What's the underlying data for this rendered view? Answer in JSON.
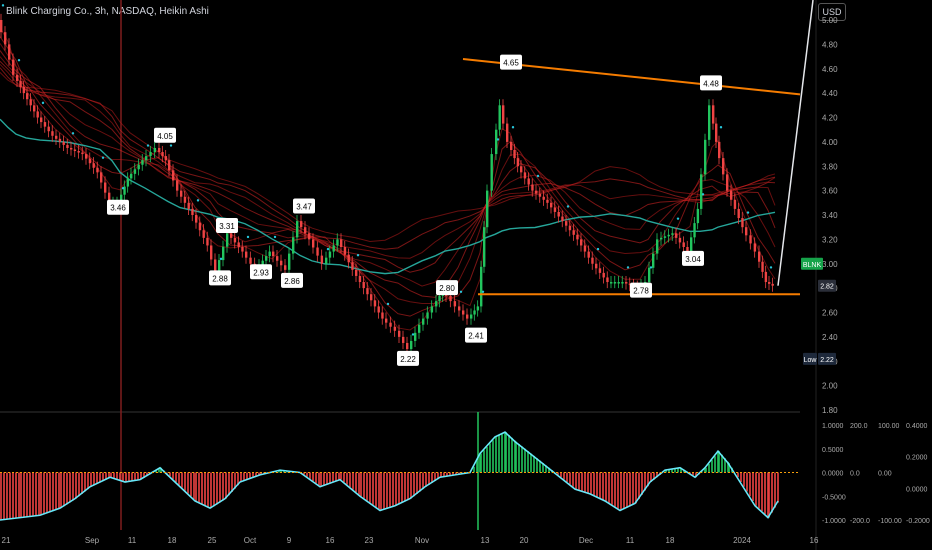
{
  "header": {
    "title": "Blink Charging Co., 3h, NASDAQ, Heikin Ashi",
    "currency": "USD"
  },
  "colors": {
    "up": "#22c55e",
    "down": "#ef4444",
    "ribbon_red": "#b91c1c",
    "ribbon_green": "#16a34a",
    "ma_teal": "#26a69a",
    "trendline": "#f57c00",
    "dots": "#26c6da"
  },
  "chart_data": [
    {
      "type": "line",
      "title": "Blink Charging Co., 3h, NASDAQ, Heikin Ashi",
      "y_axis": {
        "ylim": [
          1.8,
          5.0
        ],
        "ticks": [
          "5.00",
          "4.80",
          "4.60",
          "4.40",
          "4.20",
          "4.00",
          "3.80",
          "3.60",
          "3.40",
          "3.20",
          "3.00",
          "2.80",
          "2.60",
          "2.40",
          "2.20",
          "2.00",
          "1.80"
        ]
      },
      "x_axis": {
        "ticks": [
          "21",
          "Sep",
          "11",
          "18",
          "25",
          "Oct",
          "9",
          "16",
          "23",
          "Nov",
          "13",
          "20",
          "Dec",
          "11",
          "18",
          "2024",
          "16"
        ]
      },
      "price_series": {
        "points": [
          [
            0,
            5.0
          ],
          [
            8,
            4.8
          ],
          [
            16,
            4.55
          ],
          [
            26,
            4.4
          ],
          [
            40,
            4.2
          ],
          [
            55,
            4.05
          ],
          [
            70,
            3.95
          ],
          [
            85,
            3.9
          ],
          [
            100,
            3.75
          ],
          [
            112,
            3.5
          ],
          [
            120,
            3.5
          ],
          [
            130,
            3.7
          ],
          [
            145,
            3.85
          ],
          [
            158,
            3.95
          ],
          [
            168,
            3.85
          ],
          [
            180,
            3.6
          ],
          [
            195,
            3.4
          ],
          [
            210,
            3.15
          ],
          [
            218,
            2.92
          ],
          [
            230,
            3.25
          ],
          [
            245,
            3.1
          ],
          [
            258,
            2.95
          ],
          [
            272,
            3.1
          ],
          [
            288,
            2.95
          ],
          [
            300,
            3.35
          ],
          [
            312,
            3.2
          ],
          [
            325,
            3.0
          ],
          [
            340,
            3.2
          ],
          [
            355,
            2.95
          ],
          [
            370,
            2.75
          ],
          [
            385,
            2.55
          ],
          [
            398,
            2.45
          ],
          [
            410,
            2.3
          ],
          [
            422,
            2.5
          ],
          [
            435,
            2.65
          ],
          [
            445,
            2.78
          ],
          [
            458,
            2.65
          ],
          [
            470,
            2.55
          ],
          [
            480,
            2.65
          ],
          [
            486,
            3.3
          ],
          [
            495,
            3.9
          ],
          [
            502,
            4.3
          ],
          [
            510,
            4.0
          ],
          [
            520,
            3.8
          ],
          [
            535,
            3.6
          ],
          [
            550,
            3.5
          ],
          [
            565,
            3.35
          ],
          [
            580,
            3.2
          ],
          [
            595,
            3.0
          ],
          [
            610,
            2.85
          ],
          [
            625,
            2.85
          ],
          [
            640,
            2.8
          ],
          [
            648,
            2.85
          ],
          [
            660,
            3.2
          ],
          [
            675,
            3.25
          ],
          [
            690,
            3.1
          ],
          [
            700,
            3.45
          ],
          [
            712,
            4.3
          ],
          [
            718,
            4.0
          ],
          [
            730,
            3.6
          ],
          [
            745,
            3.3
          ],
          [
            758,
            3.1
          ],
          [
            768,
            2.85
          ],
          [
            775,
            2.82
          ]
        ]
      },
      "annotations": [
        {
          "label": "3.46",
          "x": 118,
          "y": 3.46
        },
        {
          "label": "4.05",
          "x": 165,
          "y": 4.05
        },
        {
          "label": "3.31",
          "x": 227,
          "y": 3.31
        },
        {
          "label": "2.88",
          "x": 220,
          "y": 2.88
        },
        {
          "label": "2.93",
          "x": 261,
          "y": 2.93
        },
        {
          "label": "2.86",
          "x": 292,
          "y": 2.86
        },
        {
          "label": "3.47",
          "x": 304,
          "y": 3.47
        },
        {
          "label": "2.80",
          "x": 447,
          "y": 2.8
        },
        {
          "label": "2.22",
          "x": 408,
          "y": 2.22
        },
        {
          "label": "2.41",
          "x": 476,
          "y": 2.41
        },
        {
          "label": "4.65",
          "x": 511,
          "y": 4.65
        },
        {
          "label": "2.78",
          "x": 641,
          "y": 2.78
        },
        {
          "label": "3.04",
          "x": 693,
          "y": 3.04
        },
        {
          "label": "4.48",
          "x": 711,
          "y": 4.48
        }
      ],
      "trendlines": [
        {
          "name": "resistance",
          "x": [
            463,
            800
          ],
          "y": [
            4.68,
            4.39
          ]
        },
        {
          "name": "support",
          "x": [
            478,
            800
          ],
          "y": [
            2.75,
            2.75
          ]
        }
      ],
      "price_labels": [
        {
          "text": "BLNK",
          "value": 3.0,
          "color": "#16a34a"
        },
        {
          "text": "2.82",
          "value": 2.82,
          "color": "#2a2e39"
        },
        {
          "text": "Low",
          "value": 2.22,
          "color": "#1e293b"
        },
        {
          "text": "2.22",
          "value": 2.22,
          "color": "#1e293b"
        }
      ]
    },
    {
      "type": "area",
      "title": "",
      "y_axis_left": [
        "1.0000",
        "0.5000",
        "0.0000",
        "-0.5000",
        "-1.0000"
      ],
      "y_axis_mid1": [
        "200.0",
        "0.0",
        "-200.0"
      ],
      "y_axis_mid2": [
        "100.00",
        "0.00",
        "-100.00"
      ],
      "y_axis_right": [
        "0.4000",
        "0.2000",
        "0.0000",
        "-0.2000"
      ],
      "oscillator": {
        "points": [
          [
            0,
            -1.0
          ],
          [
            20,
            -0.95
          ],
          [
            40,
            -0.9
          ],
          [
            60,
            -0.75
          ],
          [
            75,
            -0.55
          ],
          [
            90,
            -0.3
          ],
          [
            110,
            -0.1
          ],
          [
            125,
            -0.2
          ],
          [
            140,
            -0.15
          ],
          [
            160,
            0.1
          ],
          [
            175,
            -0.2
          ],
          [
            195,
            -0.6
          ],
          [
            210,
            -0.75
          ],
          [
            225,
            -0.55
          ],
          [
            240,
            -0.2
          ],
          [
            260,
            -0.05
          ],
          [
            280,
            0.05
          ],
          [
            300,
            0.0
          ],
          [
            320,
            -0.3
          ],
          [
            340,
            -0.15
          ],
          [
            360,
            -0.5
          ],
          [
            380,
            -0.8
          ],
          [
            395,
            -0.7
          ],
          [
            410,
            -0.55
          ],
          [
            425,
            -0.3
          ],
          [
            440,
            -0.1
          ],
          [
            455,
            -0.05
          ],
          [
            470,
            0.0
          ],
          [
            480,
            0.4
          ],
          [
            495,
            0.75
          ],
          [
            505,
            0.85
          ],
          [
            515,
            0.65
          ],
          [
            530,
            0.4
          ],
          [
            545,
            0.15
          ],
          [
            560,
            -0.1
          ],
          [
            575,
            -0.35
          ],
          [
            590,
            -0.45
          ],
          [
            605,
            -0.6
          ],
          [
            620,
            -0.8
          ],
          [
            635,
            -0.65
          ],
          [
            650,
            -0.2
          ],
          [
            665,
            0.05
          ],
          [
            680,
            0.1
          ],
          [
            695,
            -0.1
          ],
          [
            705,
            0.1
          ],
          [
            718,
            0.45
          ],
          [
            728,
            0.2
          ],
          [
            740,
            -0.2
          ],
          [
            755,
            -0.7
          ],
          [
            768,
            -0.95
          ],
          [
            778,
            -0.6
          ]
        ]
      }
    }
  ]
}
